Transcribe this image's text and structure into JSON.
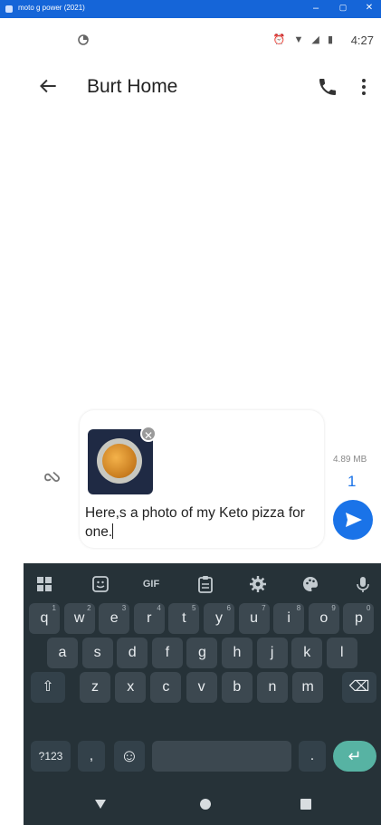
{
  "window": {
    "title": "moto g power (2021)",
    "minimize": "–",
    "maximize": "▢",
    "close": "✕"
  },
  "status": {
    "time": "4:27",
    "icons": "⏰ ▼ ◢ ▮"
  },
  "appbar": {
    "title": "Burt Home"
  },
  "compose": {
    "message": "Here,s a photo of my Keto pizza for one.",
    "attachment_size": "4.89 MB",
    "segment_count": "1",
    "remove_label": "✕"
  },
  "keyboard": {
    "toolbar": {
      "gif": "GIF"
    },
    "row1": [
      {
        "k": "q",
        "h": "1"
      },
      {
        "k": "w",
        "h": "2"
      },
      {
        "k": "e",
        "h": "3"
      },
      {
        "k": "r",
        "h": "4"
      },
      {
        "k": "t",
        "h": "5"
      },
      {
        "k": "y",
        "h": "6"
      },
      {
        "k": "u",
        "h": "7"
      },
      {
        "k": "i",
        "h": "8"
      },
      {
        "k": "o",
        "h": "9"
      },
      {
        "k": "p",
        "h": "0"
      }
    ],
    "row2": [
      "a",
      "s",
      "d",
      "f",
      "g",
      "h",
      "j",
      "k",
      "l"
    ],
    "row3": [
      "z",
      "x",
      "c",
      "v",
      "b",
      "n",
      "m"
    ],
    "symbols": "?123",
    "comma": ",",
    "period": ".",
    "emoji": "☺",
    "shift": "⇧",
    "backspace": "⌫",
    "enter": "↵"
  },
  "colors": {
    "accent": "#1a73e8",
    "keyboard_bg": "#263238",
    "enter_key": "#57b3a3"
  }
}
